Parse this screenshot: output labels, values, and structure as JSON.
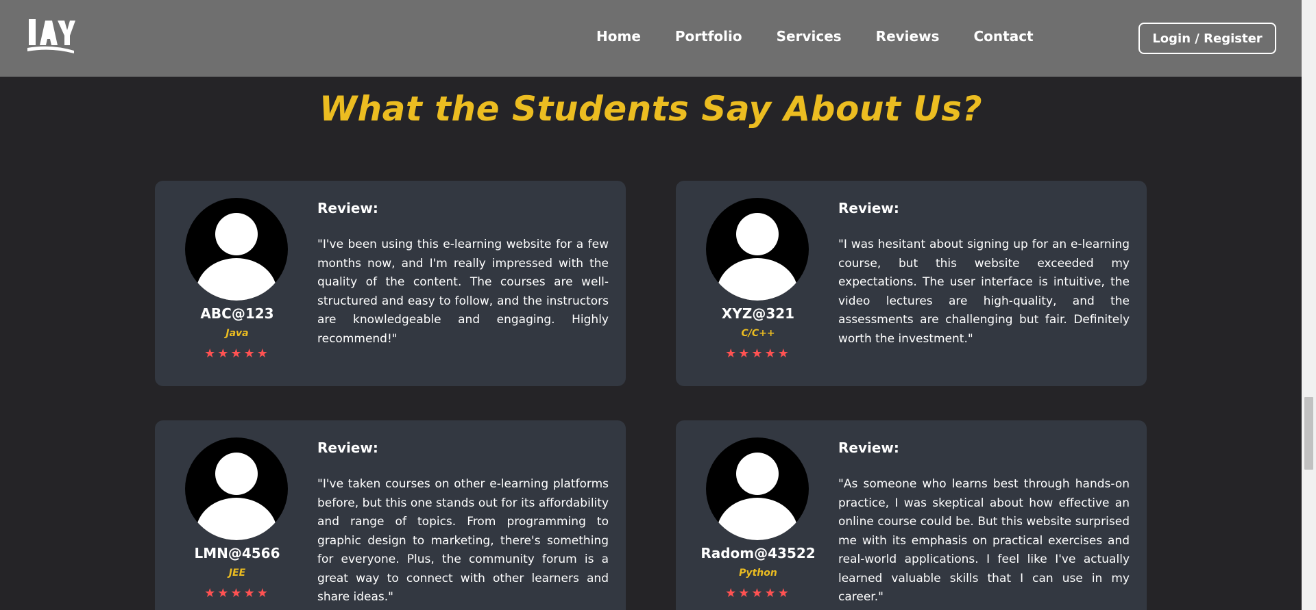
{
  "nav": {
    "logo_text": "IAY",
    "links": [
      "Home",
      "Portfolio",
      "Services",
      "Reviews",
      "Contact"
    ],
    "login_label": "Login / Register"
  },
  "section": {
    "heading": "What the Students Say About Us?"
  },
  "reviews": [
    {
      "username": "ABC@123",
      "course": "Java",
      "stars": "★★★★★",
      "label": "Review:",
      "text": "\"I've been using this e-learning website for a few months now, and I'm really impressed with the quality of the content. The courses are well-structured and easy to follow, and the instructors are knowledgeable and engaging. Highly recommend!\""
    },
    {
      "username": "XYZ@321",
      "course": "C/C++",
      "stars": "★★★★★",
      "label": "Review:",
      "text": "\"I was hesitant about signing up for an e-learning course, but this website exceeded my expectations. The user interface is intuitive, the video lectures are high-quality, and the assessments are challenging but fair. Definitely worth the investment.\""
    },
    {
      "username": "LMN@4566",
      "course": "JEE",
      "stars": "★★★★★",
      "label": "Review:",
      "text": "\"I've taken courses on other e-learning platforms before, but this one stands out for its affordability and range of topics. From programming to graphic design to marketing, there's something for everyone. Plus, the community forum is a great way to connect with other learners and share ideas.\""
    },
    {
      "username": "Radom@43522",
      "course": "Python",
      "stars": "★★★★★",
      "label": "Review:",
      "text": "\"As someone who learns best through hands-on practice, I was skeptical about how effective an online course could be. But this website surprised me with its emphasis on practical exercises and real-world applications. I feel like I've actually learned valuable skills that I can use in my career.\""
    }
  ],
  "colors": {
    "background": "#252427",
    "navbar": "#6f6f6f",
    "card": "#333841",
    "accent": "#ecbd21",
    "stars": "#ff5252"
  }
}
